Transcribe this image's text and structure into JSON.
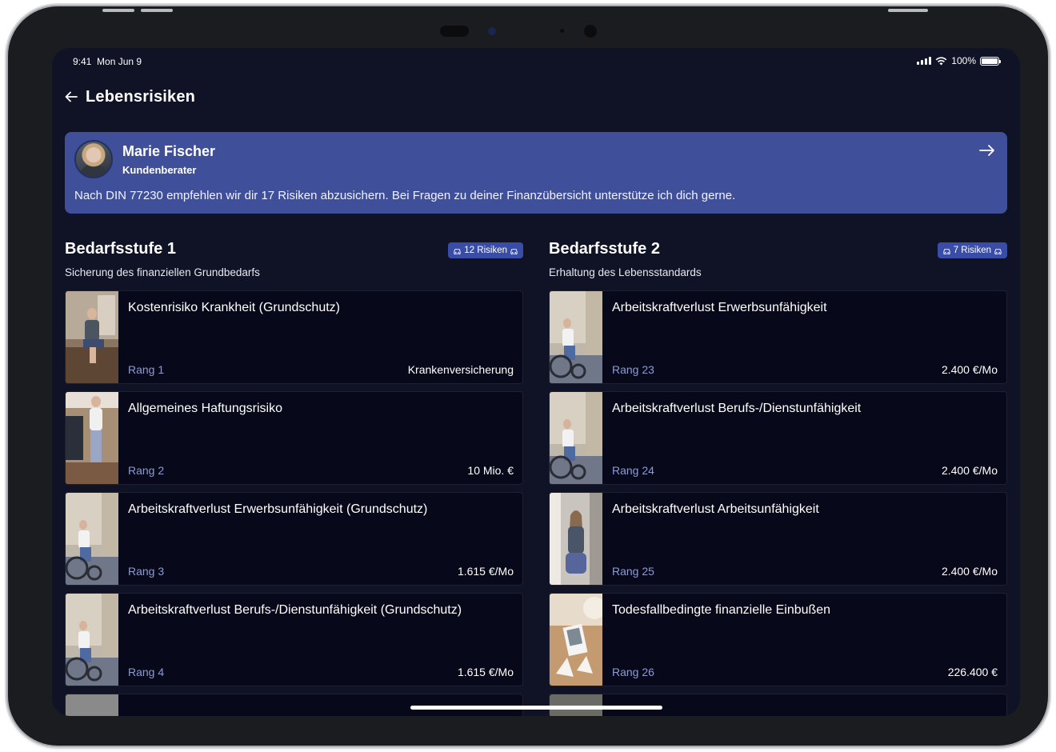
{
  "status_bar": {
    "time": "9:41",
    "date": "Mon Jun 9",
    "battery": "100%",
    "battery_level": 1.0
  },
  "header": {
    "back_icon": "arrow-left-icon",
    "title": "Lebensrisiken"
  },
  "advisor": {
    "name": "Marie Fischer",
    "role": "Kundenberater",
    "message": "Nach DIN 77230 empfehlen wir dir 17 Risiken abzusichern. Bei Fragen zu deiner Finanzübersicht unterstütze ich dich gerne.",
    "arrow_icon": "arrow-right-icon"
  },
  "stage1": {
    "title": "Bedarfsstufe 1",
    "subtitle": "Sicherung des finanziellen Grundbedarfs",
    "badge": "12 Risiken",
    "cards": [
      {
        "title": "Kostenrisiko Krankheit (Grundschutz)",
        "rank": "Rang 1",
        "value": "Krankenversicherung"
      },
      {
        "title": "Allgemeines Haftungsrisiko",
        "rank": "Rang 2",
        "value": "10 Mio. €"
      },
      {
        "title": "Arbeitskraftverlust Erwerbsunfähigkeit (Grundschutz)",
        "rank": "Rang 3",
        "value": "1.615 €/Mo"
      },
      {
        "title": "Arbeitskraftverlust Berufs-/Dienstunfähigkeit (Grundschutz)",
        "rank": "Rang 4",
        "value": "1.615 €/Mo"
      }
    ]
  },
  "stage2": {
    "title": "Bedarfsstufe 2",
    "subtitle": "Erhaltung des Lebensstandards",
    "badge": "7 Risiken",
    "cards": [
      {
        "title": "Arbeitskraftverlust Erwerbsunfähigkeit",
        "rank": "Rang 23",
        "value": "2.400 €/Mo"
      },
      {
        "title": "Arbeitskraftverlust Berufs-/Dienstunfähigkeit",
        "rank": "Rang 24",
        "value": "2.400 €/Mo"
      },
      {
        "title": "Arbeitskraftverlust Arbeitsunfähigkeit",
        "rank": "Rang 25",
        "value": "2.400 €/Mo"
      },
      {
        "title": "Todesfallbedingte finanzielle Einbußen",
        "rank": "Rang 26",
        "value": "226.400 €"
      }
    ]
  },
  "colors": {
    "background": "#101325",
    "advisor_card": "#3f4f99",
    "card": "#07091a",
    "badge": "#3a4da6",
    "rank_text": "#8f9bd0"
  }
}
